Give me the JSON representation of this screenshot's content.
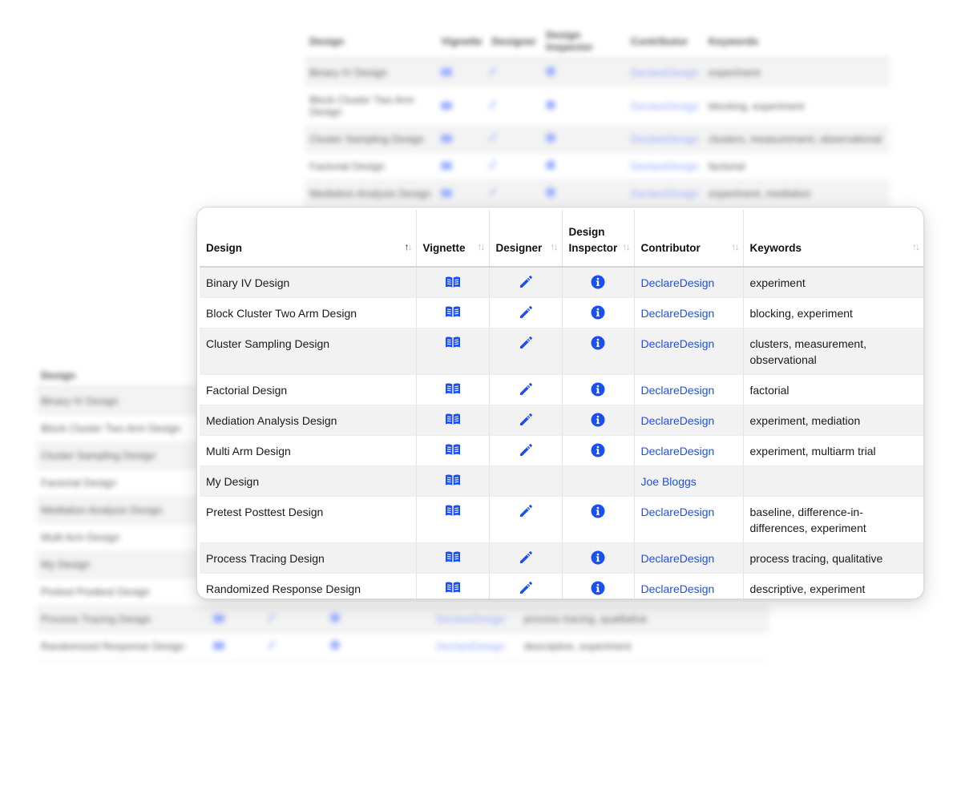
{
  "columns": [
    {
      "key": "design",
      "label": "Design",
      "sort": "asc"
    },
    {
      "key": "vignette",
      "label": "Vignette",
      "sort": "none"
    },
    {
      "key": "designer",
      "label": "Designer",
      "sort": "none"
    },
    {
      "key": "inspector",
      "label": "Design Inspector",
      "sort": "none"
    },
    {
      "key": "contributor",
      "label": "Contributor",
      "sort": "none"
    },
    {
      "key": "keywords",
      "label": "Keywords",
      "sort": "none"
    }
  ],
  "sort_icons": {
    "up": "↑",
    "down": "↓"
  },
  "rows": [
    {
      "design": "Binary IV Design",
      "vignette": true,
      "designer": true,
      "inspector": true,
      "contributor": "DeclareDesign",
      "keywords": "experiment"
    },
    {
      "design": "Block Cluster Two Arm Design",
      "vignette": true,
      "designer": true,
      "inspector": true,
      "contributor": "DeclareDesign",
      "keywords": "blocking, experiment"
    },
    {
      "design": "Cluster Sampling Design",
      "vignette": true,
      "designer": true,
      "inspector": true,
      "contributor": "DeclareDesign",
      "keywords": "clusters, measurement, observational"
    },
    {
      "design": "Factorial Design",
      "vignette": true,
      "designer": true,
      "inspector": true,
      "contributor": "DeclareDesign",
      "keywords": "factorial"
    },
    {
      "design": "Mediation Analysis Design",
      "vignette": true,
      "designer": true,
      "inspector": true,
      "contributor": "DeclareDesign",
      "keywords": "experiment, mediation"
    },
    {
      "design": "Multi Arm Design",
      "vignette": true,
      "designer": true,
      "inspector": true,
      "contributor": "DeclareDesign",
      "keywords": "experiment, multiarm trial"
    },
    {
      "design": "My Design",
      "vignette": true,
      "designer": false,
      "inspector": false,
      "contributor": "Joe Bloggs",
      "keywords": ""
    },
    {
      "design": "Pretest Posttest Design",
      "vignette": true,
      "designer": true,
      "inspector": true,
      "contributor": "DeclareDesign",
      "keywords": "baseline, difference-in-differences, experiment"
    },
    {
      "design": "Process Tracing Design",
      "vignette": true,
      "designer": true,
      "inspector": true,
      "contributor": "DeclareDesign",
      "keywords": "process tracing, qualitative"
    },
    {
      "design": "Randomized Response Design",
      "vignette": true,
      "designer": true,
      "inspector": true,
      "contributor": "DeclareDesign",
      "keywords": "descriptive, experiment"
    }
  ],
  "colors": {
    "accent": "#1a4ff0",
    "header_border": "#d5d5d5",
    "row_stripe": "#f2f2f2"
  },
  "icons": {
    "vignette": "book-open-icon",
    "designer": "pencil-icon",
    "inspector": "info-circle-icon"
  }
}
